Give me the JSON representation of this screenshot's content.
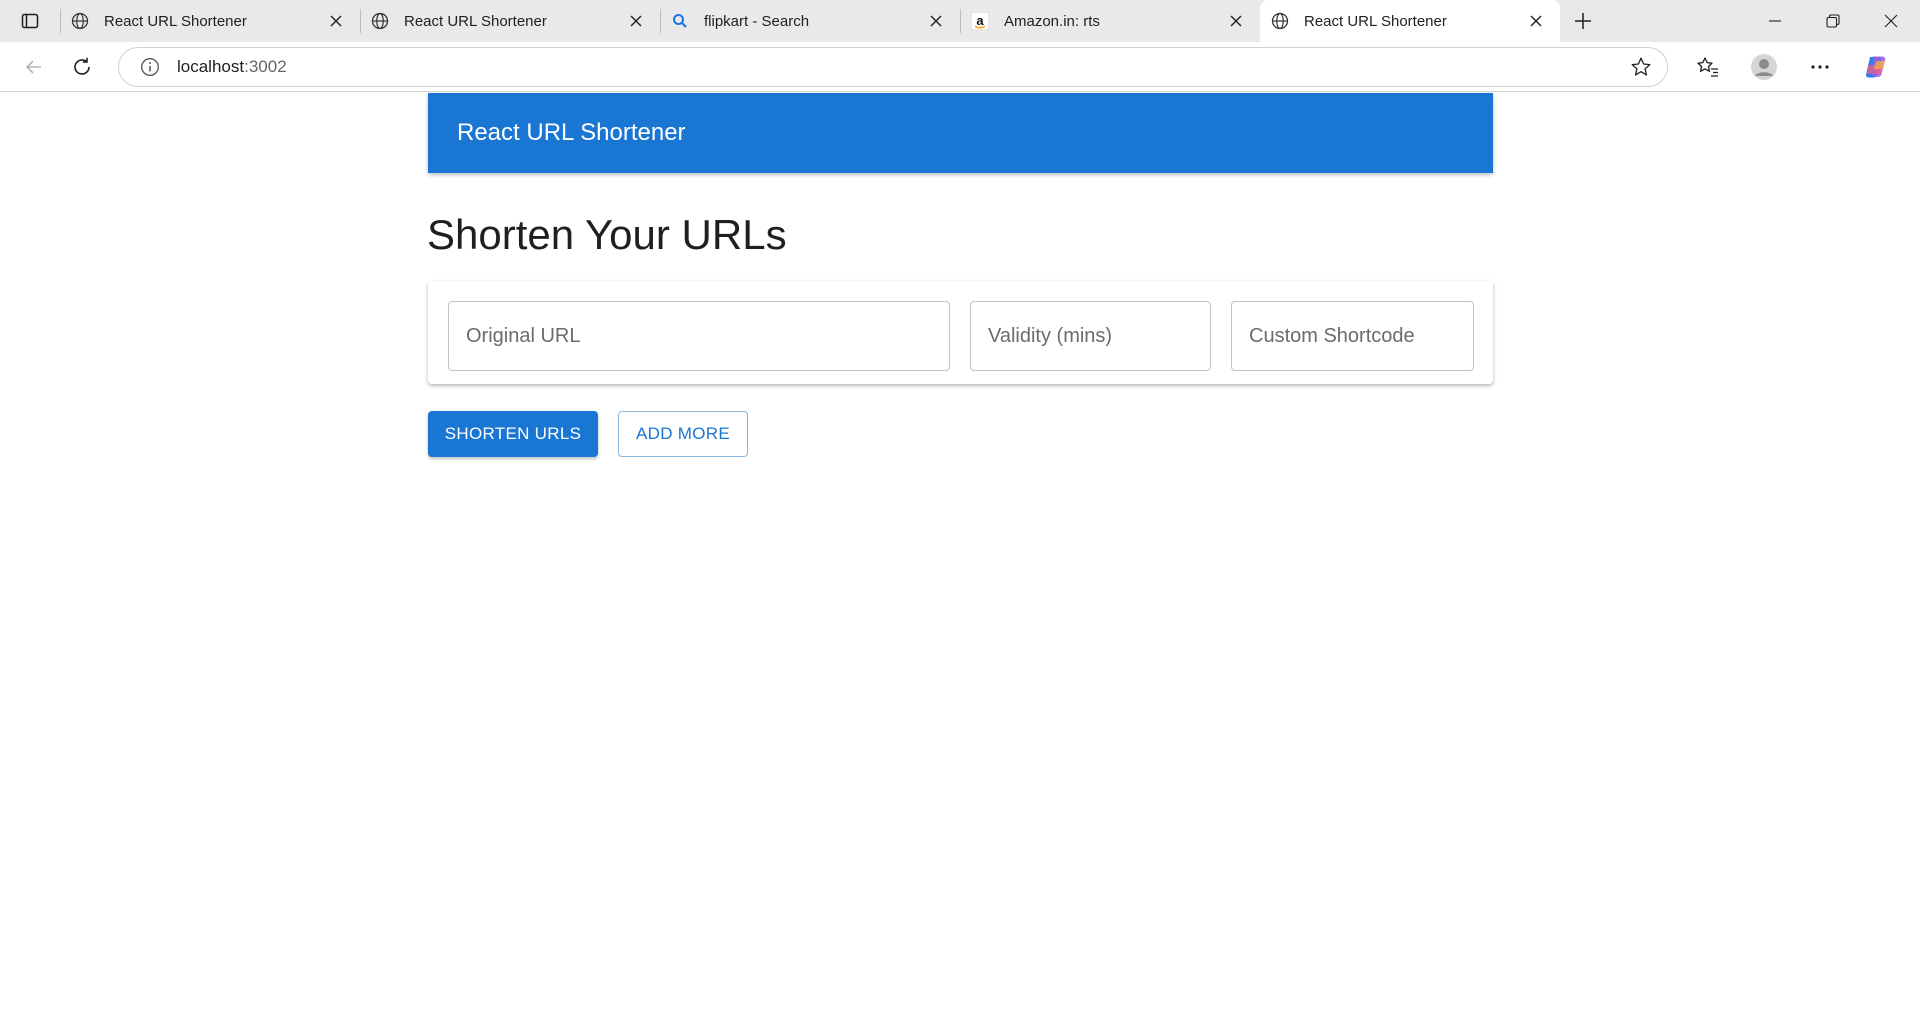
{
  "browser": {
    "tabs": [
      {
        "title": "React URL Shortener",
        "favicon": "globe-icon",
        "active": false
      },
      {
        "title": "React URL Shortener",
        "favicon": "globe-icon",
        "active": false
      },
      {
        "title": "flipkart - Search",
        "favicon": "search-icon",
        "active": false
      },
      {
        "title": "Amazon.in: rts",
        "favicon": "amazon-icon",
        "active": false
      },
      {
        "title": "React URL Shortener",
        "favicon": "globe-icon",
        "active": true
      }
    ],
    "address": {
      "host": "localhost",
      "port": ":3002"
    }
  },
  "app": {
    "appbar_title": "React URL Shortener",
    "heading": "Shorten Your URLs",
    "form": {
      "original_url_placeholder": "Original URL",
      "validity_placeholder": "Validity (mins)",
      "shortcode_placeholder": "Custom Shortcode"
    },
    "buttons": {
      "shorten": "SHORTEN URLS",
      "add_more": "ADD MORE"
    }
  },
  "colors": {
    "primary": "#1976d2",
    "chrome_bg": "#e9e9e9"
  }
}
